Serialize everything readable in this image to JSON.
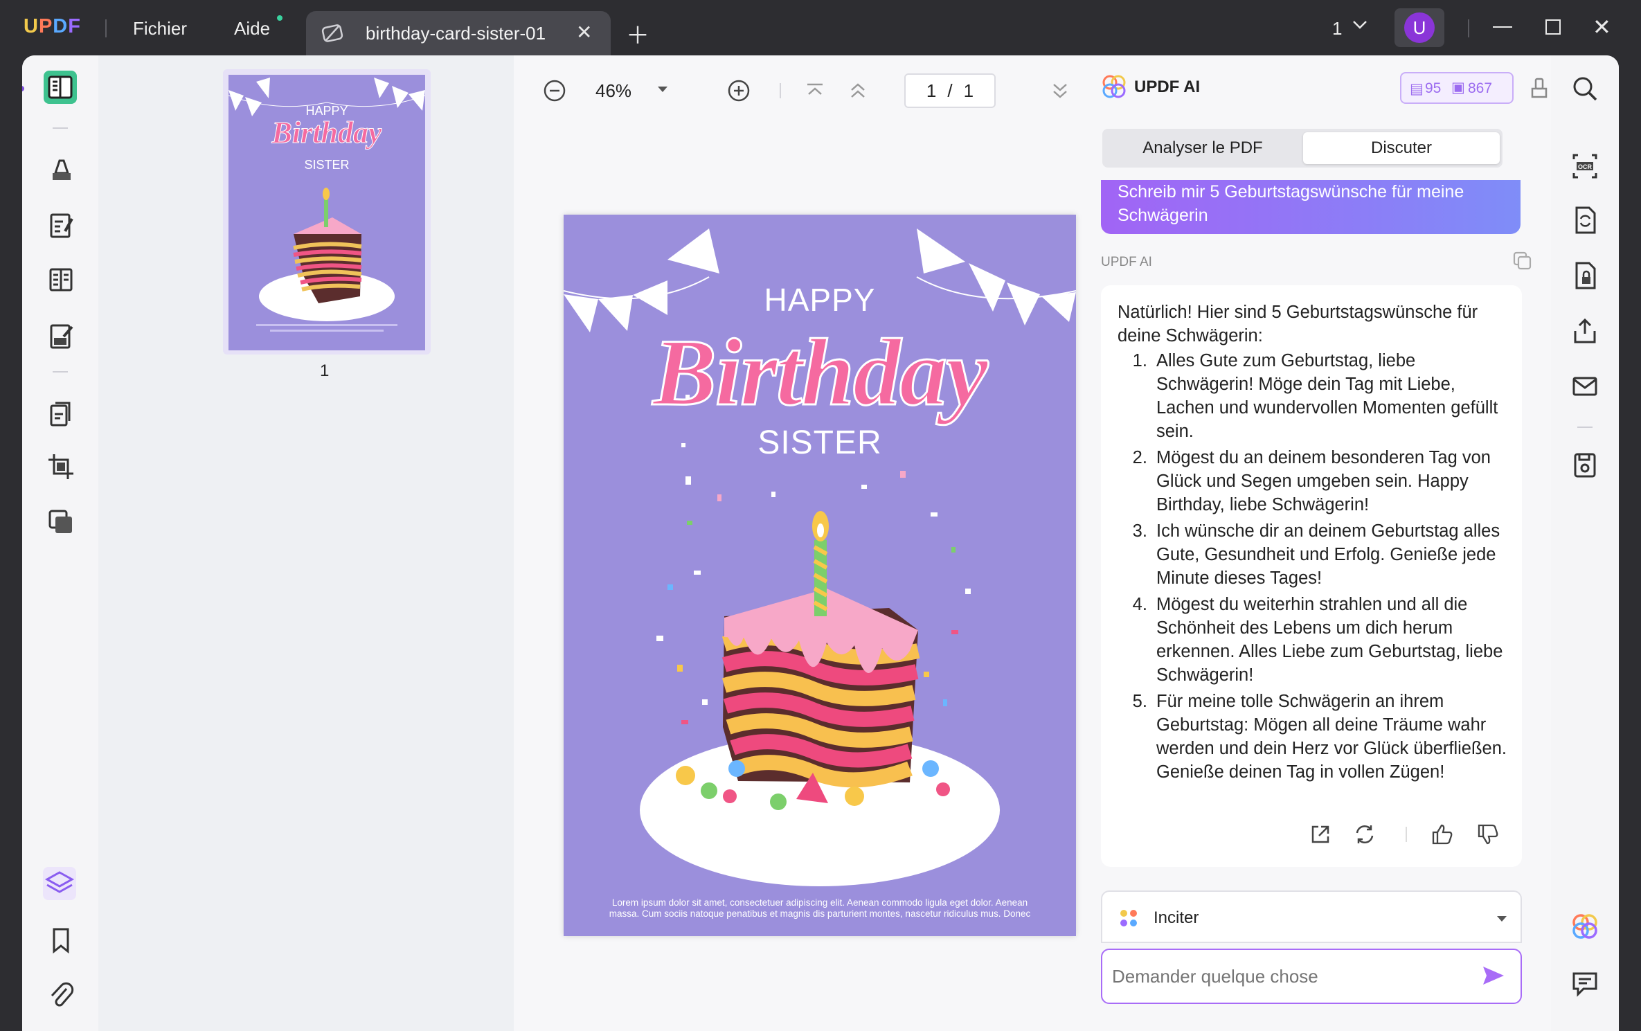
{
  "app": {
    "brand": "UPDF",
    "menu_file": "Fichier",
    "menu_help": "Aide"
  },
  "tab": {
    "title": "birthday-card-sister-01"
  },
  "titlebar": {
    "window_count": "1",
    "avatar_letter": "U"
  },
  "toolbar": {
    "zoom": "46%",
    "page_current": "1",
    "page_sep": "/",
    "page_total": "1"
  },
  "thumbnail": {
    "page_label": "1"
  },
  "card": {
    "line1": "HAPPY",
    "line2": "Birthday",
    "line3": "SISTER",
    "footer": "Lorem ipsum dolor sit amet, consectetuer adipiscing elit. Aenean commodo ligula eget dolor. Aenean massa. Cum sociis natoque penatibus et magnis dis parturient montes, nascetur ridiculus mus. Donec"
  },
  "ai": {
    "title": "UPDF AI",
    "credits_docs": "95",
    "credits_chat": "867",
    "tab_analyze": "Analyser le PDF",
    "tab_chat": "Discuter",
    "user_message": "Schreib mir 5 Geburtstagswünsche für meine Schwägerin",
    "sender": "UPDF AI",
    "intro": "Natürlich! Hier sind 5 Geburtstagswünsche für deine Schwägerin:",
    "wishes": [
      "Alles Gute zum Geburtstag, liebe Schwägerin! Möge dein Tag mit Liebe, Lachen und wundervollen Momenten gefüllt sein.",
      "Mögest du an deinem besonderen Tag von Glück und Segen umgeben sein. Happy Birthday, liebe Schwägerin!",
      "Ich wünsche dir an deinem Geburtstag alles Gute, Gesundheit und Erfolg. Genieße jede Minute dieses Tages!",
      "Mögest du weiterhin strahlen und all die Schönheit des Lebens um dich herum erkennen. Alles Liebe zum Geburtstag, liebe Schwägerin!",
      "Für meine tolle Schwägerin an ihrem Geburtstag: Mögen all deine Träume wahr werden und dein Herz vor Glück überfließen. Genieße deinen Tag in vollen Zügen!"
    ],
    "prompt_label": "Inciter",
    "input_placeholder": "Demander quelque chose"
  },
  "colors": {
    "accent": "#a86cf7",
    "card_bg": "#9b8fdc",
    "active_tool": "#3ec28f"
  }
}
